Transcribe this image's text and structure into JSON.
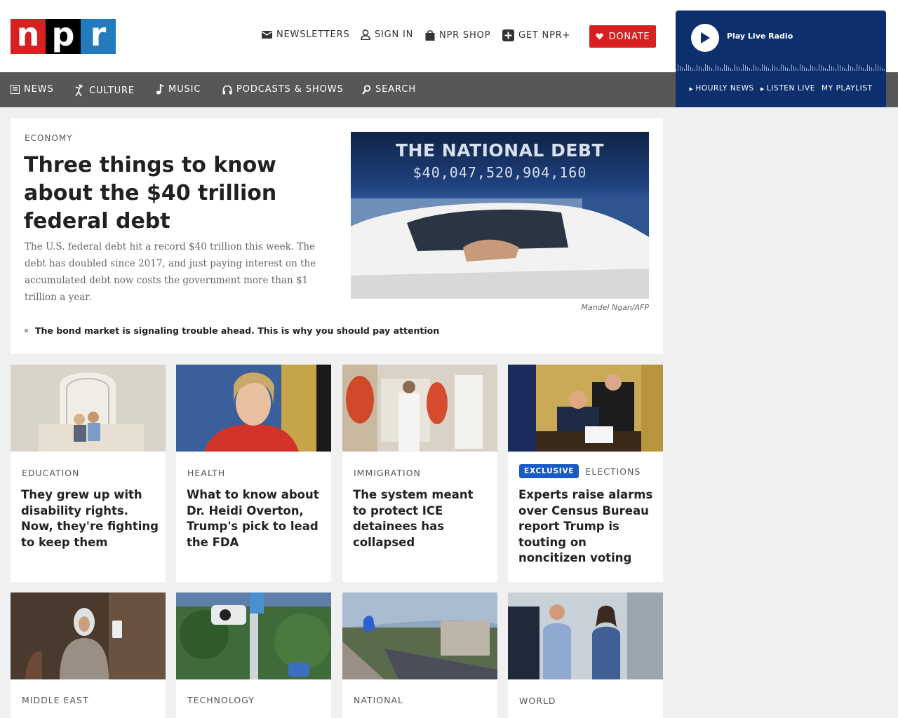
{
  "header": {
    "logo_letters": [
      "n",
      "p",
      "r"
    ],
    "utility": {
      "newsletters": "NEWSLETTERS",
      "sign_in": "SIGN IN",
      "shop": "NPR SHOP",
      "get_npr_plus": "GET NPR+"
    },
    "donate": "DONATE"
  },
  "player": {
    "play_label": "Play Live Radio",
    "links": [
      "HOURLY NEWS",
      "LISTEN LIVE",
      "MY PLAYLIST"
    ]
  },
  "nav": {
    "news": "NEWS",
    "culture": "CULTURE",
    "music": "MUSIC",
    "podcasts": "PODCASTS & SHOWS",
    "search": "SEARCH"
  },
  "hero": {
    "slug": "ECONOMY",
    "title": "Three things to know about the $40 trillion federal debt",
    "teaser": "The U.S. federal debt hit a record $40 trillion this week. The debt has doubled since 2017, and just paying interest on the accumulated debt now costs the government more than $1 trillion a year.",
    "image_sign_title": "THE NATIONAL DEBT",
    "image_sign_number": "$40,047,520,904,160",
    "credit": "Mandel Ngan/AFP",
    "related": "The bond market is signaling trouble ahead. This is why you should pay attention"
  },
  "cards_row1": [
    {
      "slug": "EDUCATION",
      "title": "They grew up with disability rights. Now, they're fighting to keep them"
    },
    {
      "slug": "HEALTH",
      "title": "What to know about Dr. Heidi Overton, Trump's pick to lead the FDA"
    },
    {
      "slug": "IMMIGRATION",
      "title": "The system meant to protect ICE detainees has collapsed"
    },
    {
      "badge": "EXCLUSIVE",
      "slug": "ELECTIONS",
      "title": "Experts raise alarms over Census Bureau report Trump is touting on noncitizen voting"
    }
  ],
  "cards_row2": [
    {
      "slug": "MIDDLE EAST"
    },
    {
      "slug": "TECHNOLOGY"
    },
    {
      "slug": "NATIONAL"
    },
    {
      "slug": "WORLD"
    }
  ],
  "colors": {
    "npr_red": "#d62021",
    "npr_black": "#000000",
    "npr_blue": "#237bbd",
    "nav_gray": "#575757",
    "player_navy": "#0e2f6d",
    "badge_blue": "#1a5ac6"
  },
  "icons": {
    "newsletters": "envelope-icon",
    "sign_in": "user-icon",
    "shop": "shopping-bag-icon",
    "get_npr_plus": "plus-square-icon",
    "donate": "heart-icon",
    "play": "play-icon",
    "news": "newspaper-icon",
    "culture": "dancer-icon",
    "music": "music-note-icon",
    "podcasts": "headphones-icon",
    "search": "search-icon"
  }
}
